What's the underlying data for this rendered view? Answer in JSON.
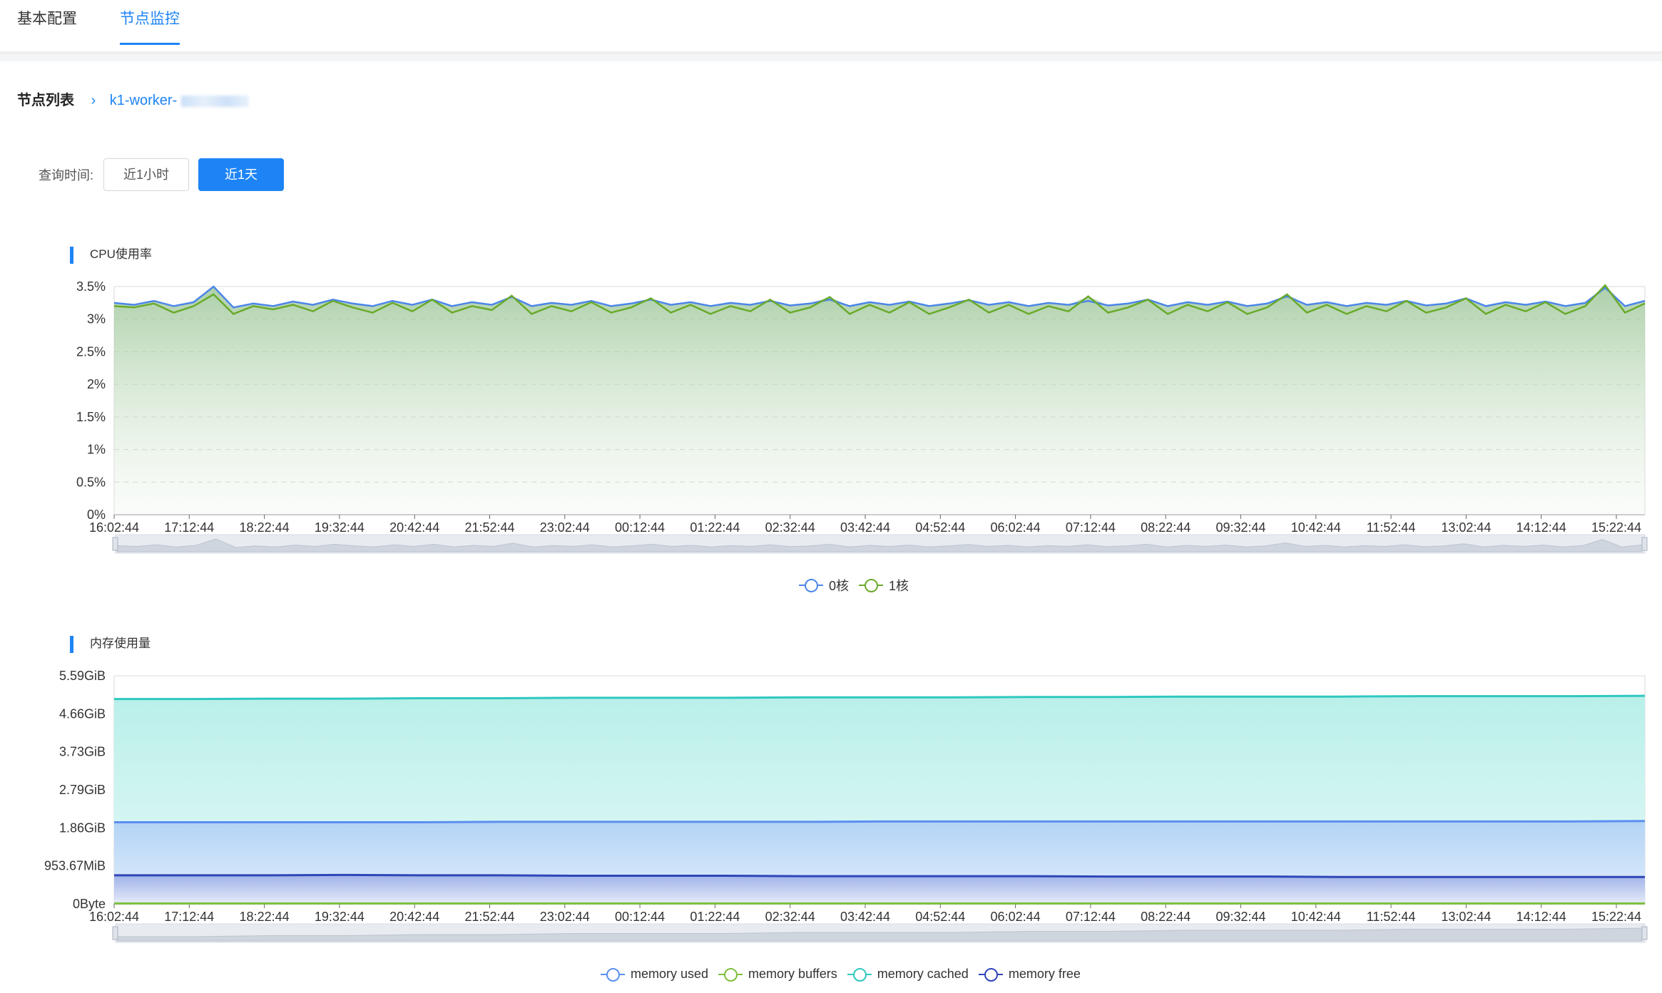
{
  "tabs": [
    {
      "label": "基本配置",
      "active": false
    },
    {
      "label": "节点监控",
      "active": true
    }
  ],
  "breadcrumb": {
    "root": "节点列表",
    "node": "k1-worker-"
  },
  "query": {
    "label": "查询时间:",
    "options": [
      {
        "label": "近1小时",
        "selected": false
      },
      {
        "label": "近1天",
        "selected": true
      }
    ]
  },
  "colors": {
    "accent": "#1e84f5",
    "core0": "#4c86e8",
    "core1": "#6aaa2c",
    "mem_used": "#5b8ff0",
    "mem_buffers": "#7fbf3f",
    "mem_cached": "#2ec8c0",
    "mem_free": "#2f46b8"
  },
  "chart_data": [
    {
      "type": "area",
      "title": "CPU使用率",
      "x_ticks": [
        "16:02:44",
        "17:12:44",
        "18:22:44",
        "19:32:44",
        "20:42:44",
        "21:52:44",
        "23:02:44",
        "00:12:44",
        "01:22:44",
        "02:32:44",
        "03:42:44",
        "04:52:44",
        "06:02:44",
        "07:12:44",
        "08:22:44",
        "09:32:44",
        "10:42:44",
        "11:52:44",
        "13:02:44",
        "14:12:44",
        "15:22:44"
      ],
      "y_ticks": [
        "0%",
        "0.5%",
        "1%",
        "1.5%",
        "2%",
        "2.5%",
        "3%",
        "3.5%"
      ],
      "ylim": [
        0,
        3.5
      ],
      "unit": "%",
      "grid": true,
      "legend_position": "bottom-center",
      "series": [
        {
          "name": "0核",
          "values": [
            3.25,
            3.22,
            3.28,
            3.2,
            3.26,
            3.5,
            3.18,
            3.24,
            3.2,
            3.27,
            3.22,
            3.3,
            3.24,
            3.2,
            3.28,
            3.22,
            3.3,
            3.2,
            3.26,
            3.22,
            3.34,
            3.2,
            3.25,
            3.22,
            3.28,
            3.2,
            3.24,
            3.3,
            3.22,
            3.26,
            3.2,
            3.25,
            3.22,
            3.28,
            3.21,
            3.24,
            3.3,
            3.2,
            3.26,
            3.22,
            3.27,
            3.2,
            3.24,
            3.29,
            3.22,
            3.26,
            3.2,
            3.25,
            3.22,
            3.28,
            3.21,
            3.24,
            3.3,
            3.2,
            3.26,
            3.22,
            3.27,
            3.2,
            3.24,
            3.35,
            3.22,
            3.26,
            3.2,
            3.25,
            3.22,
            3.28,
            3.21,
            3.24,
            3.32,
            3.2,
            3.26,
            3.22,
            3.27,
            3.2,
            3.25,
            3.48,
            3.2,
            3.28
          ]
        },
        {
          "name": "1核",
          "values": [
            3.2,
            3.18,
            3.24,
            3.1,
            3.2,
            3.38,
            3.08,
            3.2,
            3.15,
            3.22,
            3.12,
            3.28,
            3.18,
            3.1,
            3.25,
            3.12,
            3.3,
            3.1,
            3.2,
            3.14,
            3.36,
            3.08,
            3.2,
            3.12,
            3.26,
            3.1,
            3.18,
            3.32,
            3.1,
            3.22,
            3.08,
            3.2,
            3.12,
            3.3,
            3.1,
            3.18,
            3.34,
            3.08,
            3.22,
            3.1,
            3.26,
            3.08,
            3.18,
            3.3,
            3.1,
            3.22,
            3.08,
            3.2,
            3.12,
            3.35,
            3.1,
            3.18,
            3.3,
            3.08,
            3.22,
            3.12,
            3.26,
            3.08,
            3.18,
            3.38,
            3.1,
            3.22,
            3.08,
            3.2,
            3.12,
            3.28,
            3.1,
            3.18,
            3.32,
            3.08,
            3.22,
            3.12,
            3.26,
            3.08,
            3.2,
            3.52,
            3.1,
            3.24
          ]
        }
      ]
    },
    {
      "type": "area",
      "title": "内存使用量",
      "x_ticks": [
        "16:02:44",
        "17:12:44",
        "18:22:44",
        "19:32:44",
        "20:42:44",
        "21:52:44",
        "23:02:44",
        "00:12:44",
        "01:22:44",
        "02:32:44",
        "03:42:44",
        "04:52:44",
        "06:02:44",
        "07:12:44",
        "08:22:44",
        "09:32:44",
        "10:42:44",
        "11:52:44",
        "13:02:44",
        "14:12:44",
        "15:22:44"
      ],
      "y_ticks": [
        "0Byte",
        "953.67MiB",
        "1.86GiB",
        "2.79GiB",
        "3.73GiB",
        "4.66GiB",
        "5.59GiB"
      ],
      "ylim_gib": [
        0,
        5.59
      ],
      "grid": true,
      "legend_position": "bottom-center",
      "series": [
        {
          "name": "memory used",
          "values_gib": [
            2.0,
            2.0,
            2.0,
            2.0,
            2.0,
            2.01,
            2.01,
            2.01,
            2.01,
            2.01,
            2.02,
            2.02,
            2.02,
            2.02,
            2.02,
            2.02,
            2.02,
            2.02,
            2.02,
            2.02,
            2.03
          ]
        },
        {
          "name": "memory buffers",
          "values_gib": [
            0.0,
            0.0,
            0.0,
            0.0,
            0.0,
            0.0,
            0.0,
            0.0,
            0.0,
            0.0,
            0.0,
            0.0,
            0.0,
            0.0,
            0.0,
            0.0,
            0.0,
            0.0,
            0.0,
            0.0,
            0.0
          ]
        },
        {
          "name": "memory cached",
          "values_gib": [
            5.02,
            5.02,
            5.03,
            5.03,
            5.04,
            5.04,
            5.05,
            5.05,
            5.05,
            5.06,
            5.06,
            5.06,
            5.07,
            5.07,
            5.08,
            5.08,
            5.08,
            5.09,
            5.09,
            5.09,
            5.1
          ]
        },
        {
          "name": "memory free",
          "values_gib": [
            0.7,
            0.7,
            0.7,
            0.71,
            0.7,
            0.7,
            0.69,
            0.69,
            0.69,
            0.68,
            0.68,
            0.68,
            0.68,
            0.67,
            0.67,
            0.67,
            0.66,
            0.66,
            0.66,
            0.66,
            0.66
          ]
        }
      ]
    }
  ]
}
